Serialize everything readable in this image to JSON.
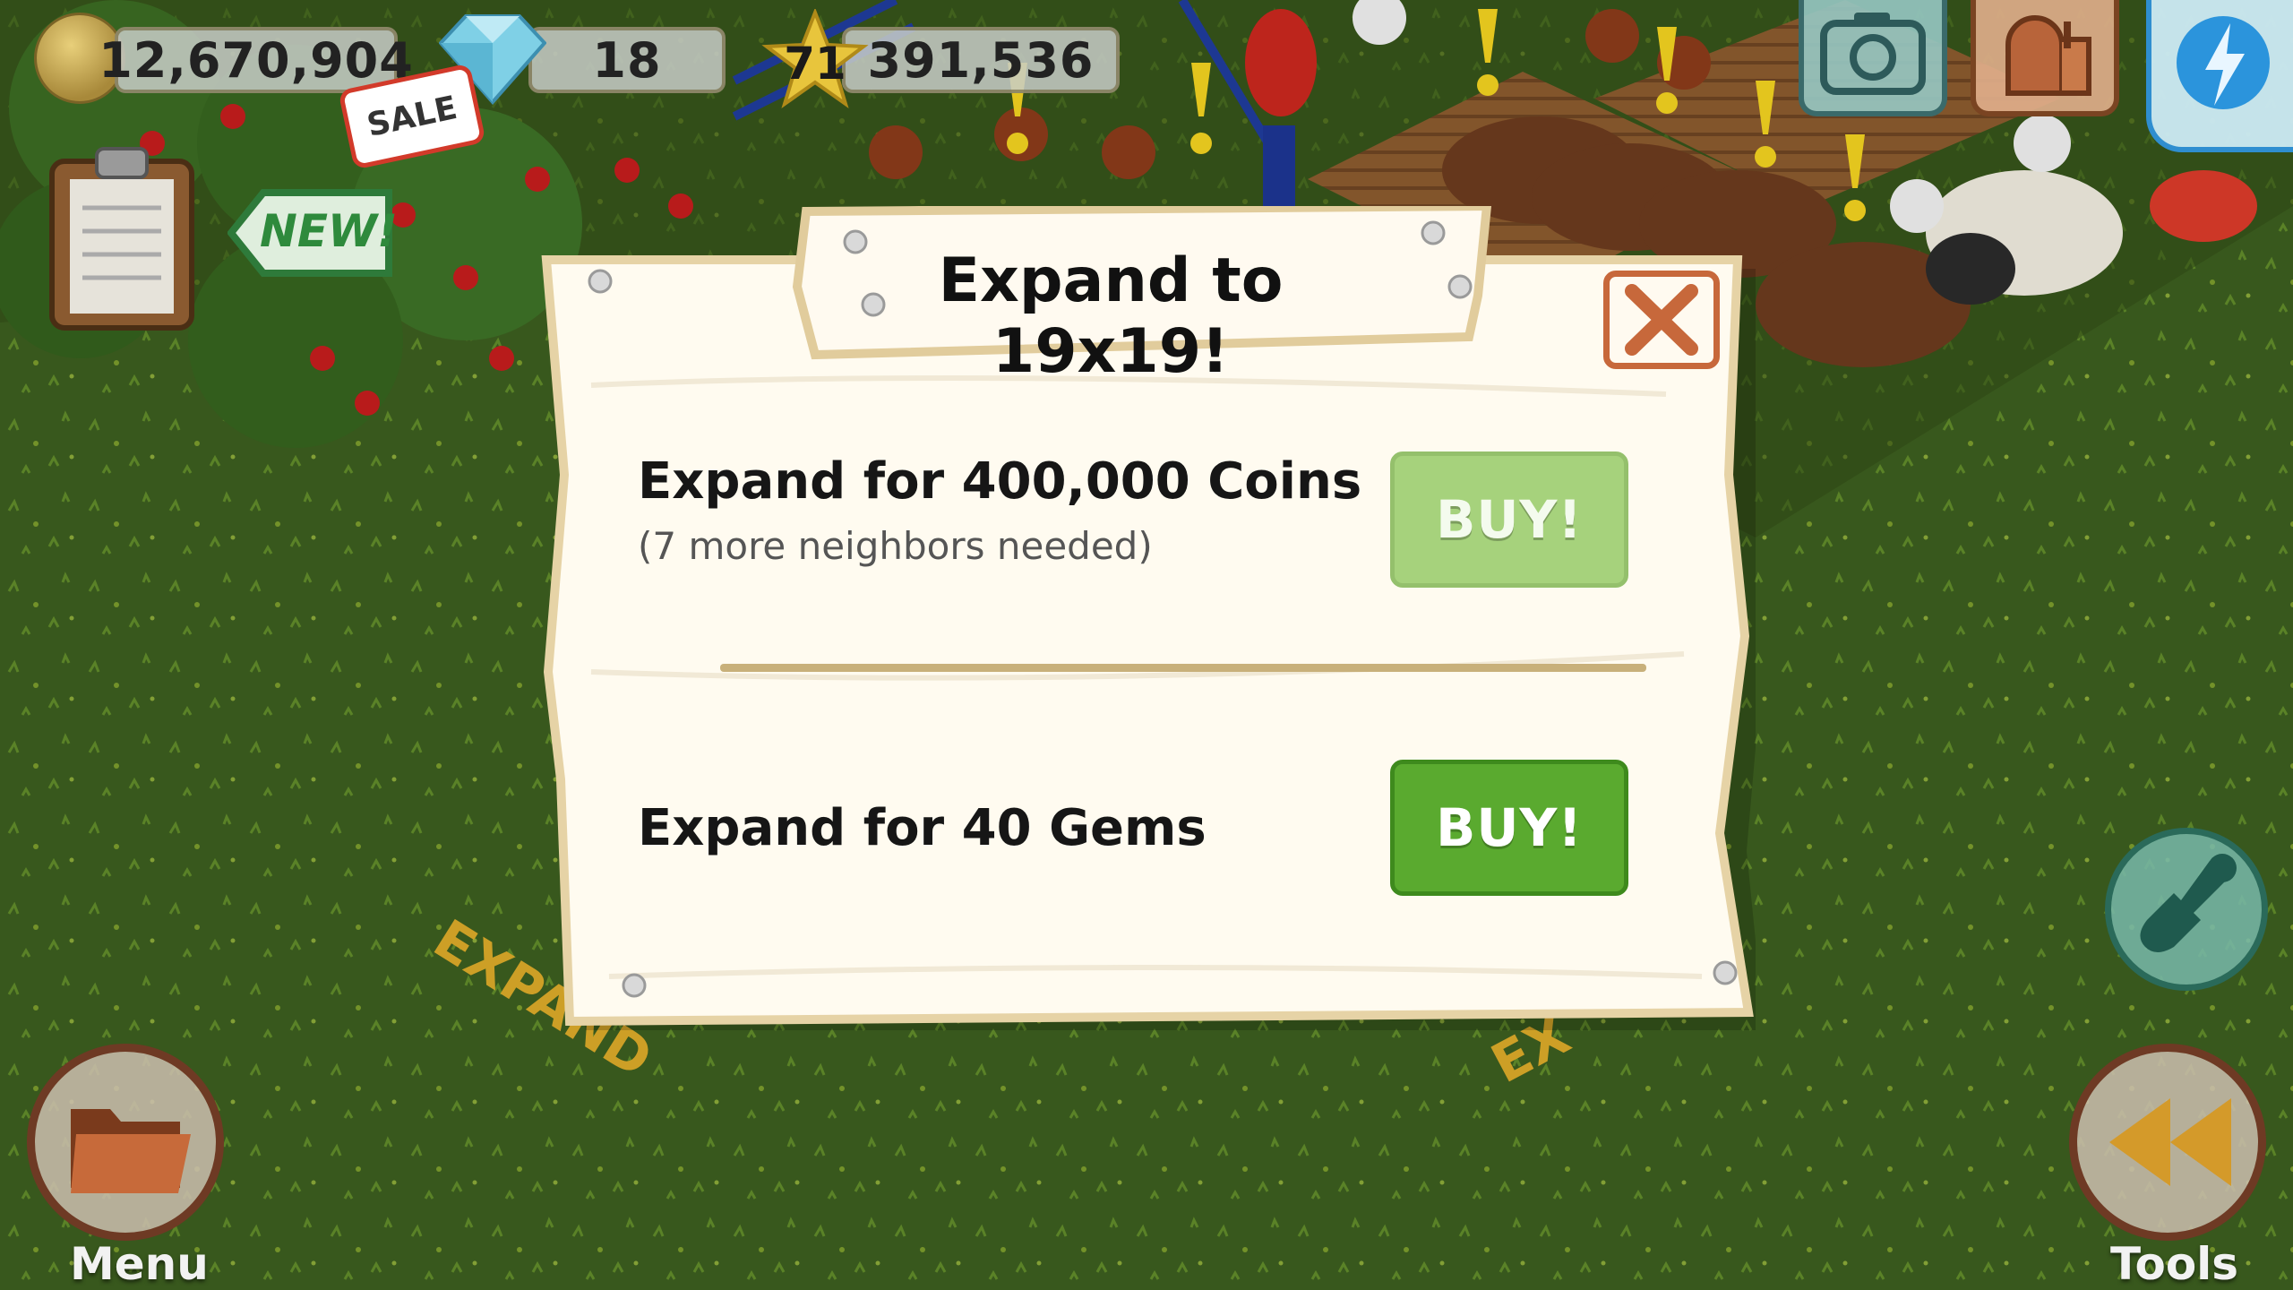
{
  "hud": {
    "coins": "12,670,904",
    "gems": "18",
    "level": "71",
    "xp": "391,536"
  },
  "signs": {
    "sale": "SALE",
    "new": "NEW!",
    "expand_ground_left": "EXPAND",
    "expand_ground_right": "EX"
  },
  "dialog": {
    "title": "Expand to 19x19!",
    "close_label": "X",
    "options": [
      {
        "title": "Expand for 400,000 Coins",
        "subtitle": "(7 more neighbors needed)",
        "button": "BUY!",
        "enabled": false
      },
      {
        "title": "Expand for 40 Gems",
        "button": "BUY!",
        "enabled": true
      }
    ]
  },
  "bottom": {
    "menu_label": "Menu",
    "tools_label": "Tools"
  },
  "colors": {
    "grass": "#3b5c1e",
    "buy_enabled": "#5aaa2f",
    "buy_disabled": "#a6d27c",
    "close_border": "#c7683b"
  },
  "icons": {
    "coin": "coin-icon",
    "gem": "diamond-icon",
    "level": "star-badge-icon",
    "camera": "camera-icon",
    "mailbox": "mailbox-icon",
    "social": "lightning-globe-icon",
    "clipboard": "clipboard-icon",
    "shovel": "shovel-icon",
    "menu": "folder-icon",
    "tools": "rewind-icon"
  }
}
